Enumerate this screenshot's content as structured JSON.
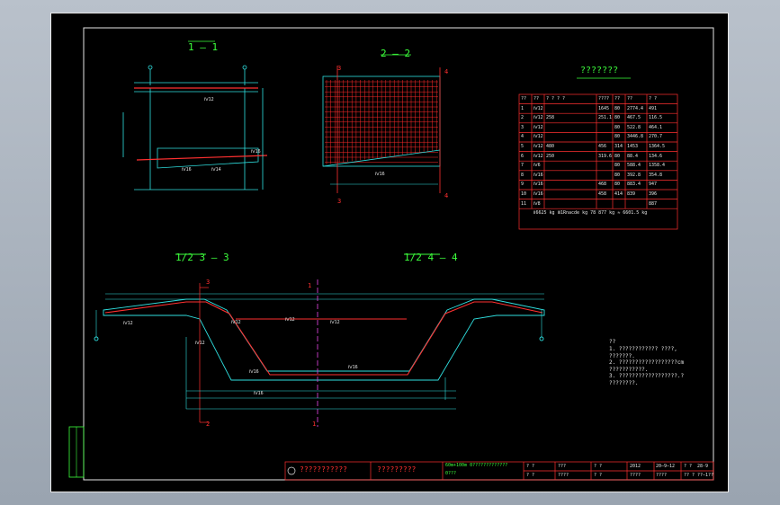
{
  "drawing": {
    "section_labels": {
      "s11": "1 — 1",
      "s22": "2 — 2",
      "s33": "1/2  3 — 3",
      "s44": "1/2  4 — 4"
    },
    "table_title": "???????",
    "table_header": [
      "??",
      "??",
      "? ? ? ?",
      "????",
      "??",
      "??",
      "? ?"
    ],
    "table_rows": [
      [
        "1",
        "Ⅳ12",
        "",
        "1645",
        "80",
        "2774.4",
        "491"
      ],
      [
        "2",
        "Ⅳ12",
        "258",
        "251.1",
        "80",
        "467.5",
        "116.5"
      ],
      [
        "3",
        "Ⅳ12",
        "",
        "",
        "80",
        "522.8",
        "464.1"
      ],
      [
        "4",
        "Ⅳ12",
        "",
        "",
        "80",
        "3446.8",
        "270.7"
      ],
      [
        "5",
        "Ⅳ12",
        "480",
        "456",
        "314",
        "1453",
        "1364.5"
      ],
      [
        "6",
        "Ⅳ12",
        "250",
        "319.6",
        "80",
        "88.4",
        "134.6"
      ],
      [
        "7",
        "Ⅳ6",
        "",
        "",
        "80",
        "588.4",
        "1358.4"
      ],
      [
        "8",
        "Ⅳ16",
        "",
        "",
        "80",
        "392.8",
        "354.8"
      ],
      [
        "9",
        "Ⅳ16",
        "",
        "468",
        "80",
        "883.4",
        "947"
      ],
      [
        "10",
        "Ⅳ16",
        "",
        "458",
        "414",
        "839",
        "396"
      ],
      [
        "11",
        "Ⅳ8",
        "",
        "",
        "",
        "",
        "887"
      ]
    ],
    "table_total": "Ⅱ6625 kg    Ⅲ1Rnacde kg  78 877 kg    ≈ 6601.5 kg",
    "notes_heading": "??",
    "notes": [
      "1. ???????????? ????,",
      "   ???????.",
      "2. ??????????????????cm",
      "   ???????????.",
      "3. ??????????????????.?",
      "   ????????."
    ],
    "title_block": {
      "company": "???????????",
      "drawing_name": "?????????",
      "project": "60m+100m 0?????????????",
      "subtitle": "0???",
      "c1": "? ?",
      "c2": "???",
      "c3": "? ?",
      "c4": "????",
      "c5": "2012",
      "date": "20—9—12",
      "scale": "? ?",
      "sheet": "28-9",
      "sheet_no": "??",
      "row2_c1": "? ?",
      "row2_c2": "????",
      "row2_c3": "? ?",
      "row2_c4": "????",
      "row2_c5": "????",
      "row2_c6": "?? ?",
      "row2_c7": "??—1??"
    },
    "leader_labels": {
      "n12": "Ⅳ12",
      "n16": "Ⅳ16",
      "n14": "Ⅳ14",
      "n18": "Ⅳ18",
      "sec_1": "1",
      "sec_2": "2",
      "sec_3": "3",
      "sec_4": "4"
    }
  }
}
